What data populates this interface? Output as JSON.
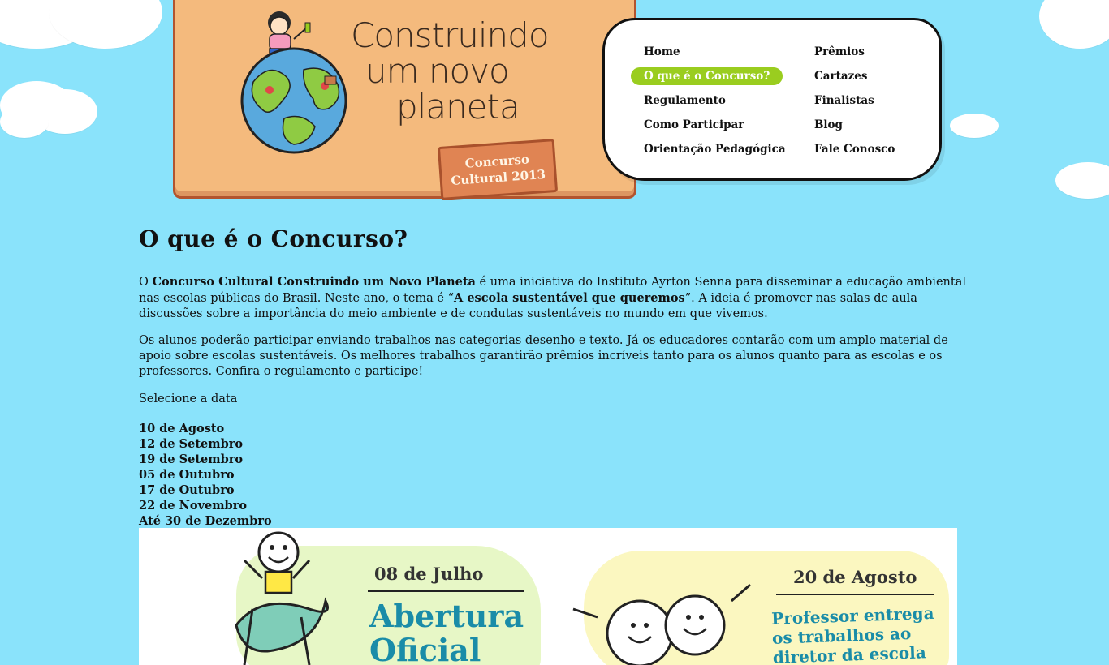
{
  "logo": {
    "line1": "Construindo",
    "line2": "um novo",
    "line3": "planeta",
    "badge_line1": "Concurso",
    "badge_line2": "Cultural 2013"
  },
  "nav": {
    "items": [
      {
        "label": "Home",
        "active": false
      },
      {
        "label": "O que é o Concurso?",
        "active": true
      },
      {
        "label": "Regulamento",
        "active": false
      },
      {
        "label": "Como Participar",
        "active": false
      },
      {
        "label": "Orientação Pedagógica",
        "active": false
      },
      {
        "label": "Prêmios",
        "active": false
      },
      {
        "label": "Cartazes",
        "active": false
      },
      {
        "label": "Finalistas",
        "active": false
      },
      {
        "label": "Blog",
        "active": false
      },
      {
        "label": "Fale Conosco",
        "active": false
      }
    ],
    "active_color": "#9acd1f"
  },
  "page": {
    "title": "O que é o Concurso?",
    "p1": {
      "pre": "O ",
      "bold1": "Concurso Cultural Construindo um Novo Planeta",
      "mid": " é uma iniciativa do Instituto Ayrton Senna para disseminar a educação ambiental nas escolas públicas do Brasil. Neste ano, o tema é “",
      "bold2": "A escola sustentável que queremos",
      "post": "”. A ideia é promover nas salas de aula discussões sobre a importância do meio ambiente e de condutas sustentáveis no mundo em que vivemos."
    },
    "p2": "Os alunos poderão participar enviando trabalhos nas categorias desenho e texto. Já os educadores contarão com um amplo material de apoio sobre escolas sustentáveis. Os melhores trabalhos garantirão prêmios incríveis tanto para os alunos quanto para as escolas e os professores. Confira o regulamento e participe!",
    "select_label": "Selecione a data",
    "dates": [
      "10 de Agosto",
      "12 de Setembro",
      "19 de Setembro",
      "05 de Outubro",
      "17 de Outubro",
      "22 de Novembro",
      "Até 30 de Dezembro"
    ]
  },
  "banner": {
    "panel1": {
      "date": "08 de Julho",
      "title": "Abertura Oficial"
    },
    "panel2": {
      "date": "20 de Agosto",
      "title": "Professor entrega os trabalhos ao diretor da escola"
    }
  },
  "colors": {
    "background": "#8ae3fb",
    "title_blue": "#1a8ca8",
    "wood": "#f4ba7d"
  }
}
